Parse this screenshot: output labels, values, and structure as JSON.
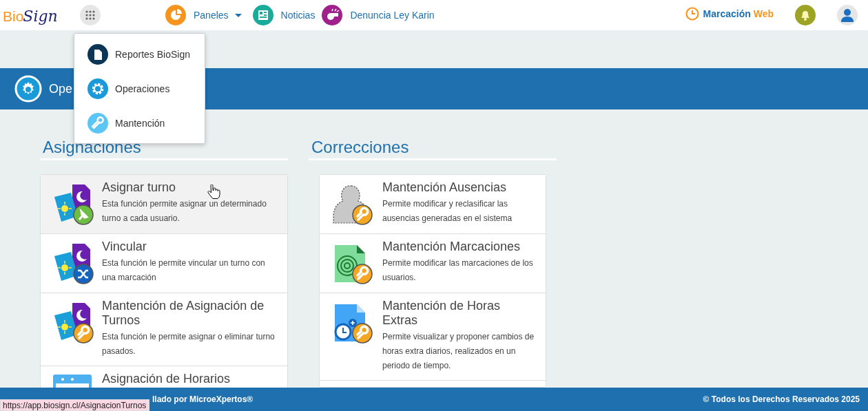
{
  "logo": {
    "part_1": "Bio",
    "part_2": "Sign"
  },
  "nav": [
    {
      "kind": "panels",
      "label": "Paneles",
      "dropdown": true
    },
    {
      "kind": "news",
      "label": "Noticias",
      "dropdown": false
    },
    {
      "kind": "report",
      "label": "Denuncia Ley Karin",
      "dropdown": false
    }
  ],
  "clock_link": {
    "part_1": "Marcación",
    "part_2": "Web"
  },
  "apps_menu": [
    {
      "kind": "doc",
      "label": "Reportes BioSign"
    },
    {
      "kind": "gear",
      "label": "Operaciones"
    },
    {
      "kind": "wrench",
      "label": "Mantención"
    }
  ],
  "page_header": {
    "title": "Ope"
  },
  "sections": [
    {
      "title": "Asignaciones",
      "cards": [
        {
          "kind": "assign",
          "title": "Asignar turno",
          "description": "Esta función permite asignar un determinado turno a cada usuario.",
          "hovered": true
        },
        {
          "kind": "link",
          "title": "Vincular",
          "description": "Esta función le permite vincular un turno con una marcación",
          "hovered": false
        },
        {
          "kind": "maintain",
          "title": "Mantención de Asignación de Turnos",
          "description": "Esta función le permite asignar o eliminar turno pasados.",
          "hovered": false
        },
        {
          "kind": "schedule",
          "title": "Asignación de Horarios",
          "hovered": false
        }
      ]
    },
    {
      "title": "Correcciones",
      "cards": [
        {
          "kind": "absence",
          "title": "Mantención Ausencias",
          "description": "Permite modificar y reclasificar las ausencias generadas en el sistema",
          "hovered": false
        },
        {
          "kind": "punch",
          "title": "Mantención Marcaciones",
          "description": "Permite modificar las marcaciones de los usuarios.",
          "hovered": false
        },
        {
          "kind": "overtime",
          "title": "Mantención de Horas Extras",
          "description": "Permite visualizar y proponer cambios de horas extra diarios, realizados en un periodo de tiempo.",
          "hovered": false
        }
      ]
    }
  ],
  "footer": {
    "left": "llado por MicroeXpertos®",
    "right": "© Todos los Derechos Reservados 2025"
  },
  "status_url": "https://app.biosign.cl/AsignacionTurnos"
}
